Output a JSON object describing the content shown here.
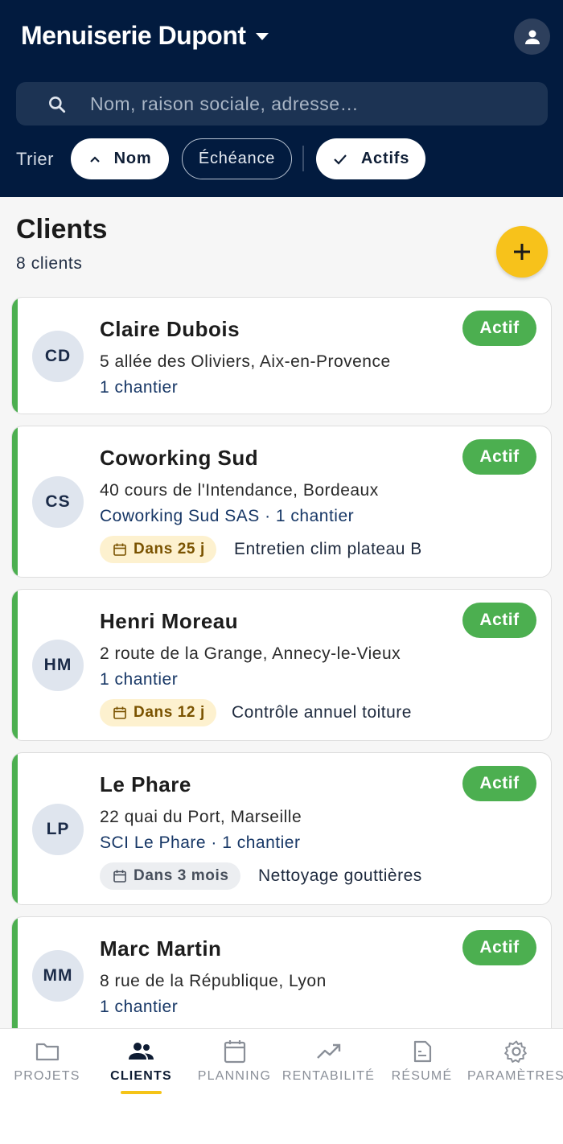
{
  "header": {
    "company": "Menuiserie Dupont",
    "search_placeholder": "Nom, raison sociale, adresse…",
    "sort_label": "Trier",
    "chips": [
      {
        "label": "Nom",
        "icon": "chevron-up-icon",
        "selected": true
      },
      {
        "label": "Échéance",
        "selected": false
      },
      {
        "label": "Actifs",
        "icon": "check-icon",
        "selected": true
      }
    ]
  },
  "main": {
    "title": "Clients",
    "count": "8 clients"
  },
  "clients": [
    {
      "initials": "CD",
      "name": "Claire Dubois",
      "address": "5 allée des Oliviers, Aix-en-Provence",
      "meta": "1 chantier",
      "status": "Actif"
    },
    {
      "initials": "CS",
      "name": "Coworking Sud",
      "address": "40 cours de l'Intendance, Bordeaux",
      "meta": "Coworking Sud SAS · 1 chantier",
      "status": "Actif",
      "due": "Dans 25 j",
      "task": "Entretien clim plateau B"
    },
    {
      "initials": "HM",
      "name": "Henri Moreau",
      "address": "2 route de la Grange, Annecy-le-Vieux",
      "meta": "1 chantier",
      "status": "Actif",
      "due": "Dans 12 j",
      "task": "Contrôle annuel toiture"
    },
    {
      "initials": "LP",
      "name": "Le Phare",
      "address": "22 quai du Port, Marseille",
      "meta": "SCI Le Phare · 1 chantier",
      "status": "Actif",
      "due": "Dans 3 mois",
      "task": "Nettoyage gouttières"
    },
    {
      "initials": "MM",
      "name": "Marc Martin",
      "address": "8 rue de la République, Lyon",
      "meta": "1 chantier",
      "status": "Actif"
    }
  ],
  "nav": [
    {
      "label": "PROJETS",
      "icon": "folder-icon"
    },
    {
      "label": "CLIENTS",
      "icon": "people-icon",
      "active": true
    },
    {
      "label": "PLANNING",
      "icon": "calendar-icon"
    },
    {
      "label": "RENTABILITÉ",
      "icon": "trending-up-icon"
    },
    {
      "label": "RÉSUMÉ",
      "icon": "document-icon"
    },
    {
      "label": "PARAMÈTRES",
      "icon": "gear-icon"
    }
  ],
  "colors": {
    "header_bg": "#021b3f",
    "accent": "#f7c21b",
    "active_green": "#4caf50"
  }
}
